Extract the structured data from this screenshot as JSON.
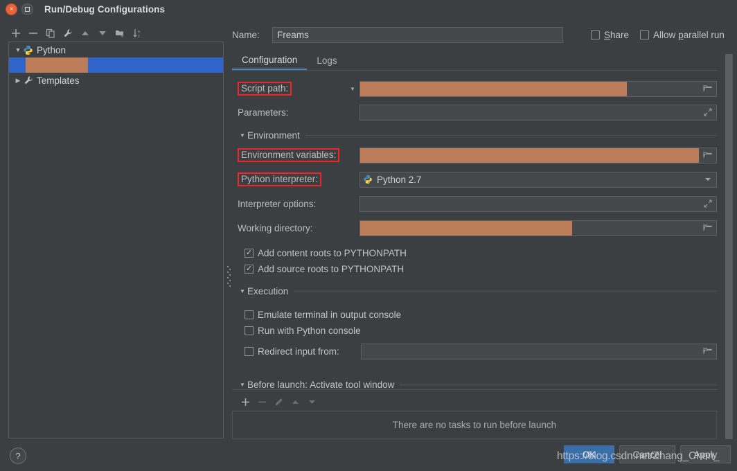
{
  "window": {
    "title": "Run/Debug Configurations",
    "close_icon": "close-icon",
    "maximize_icon": "maximize-icon"
  },
  "left_toolbar": {
    "items": [
      {
        "name": "add-configuration",
        "glyph": "+"
      },
      {
        "name": "remove-configuration",
        "glyph": "−"
      },
      {
        "name": "copy-configuration",
        "glyph": "❐"
      },
      {
        "name": "edit-templates",
        "glyph": "⚒"
      },
      {
        "name": "move-up",
        "glyph": "▲"
      },
      {
        "name": "move-down",
        "glyph": "▼"
      },
      {
        "name": "create-folder",
        "glyph": "▰"
      },
      {
        "name": "sort-configurations",
        "glyph": "↓"
      }
    ]
  },
  "tree": {
    "nodes": [
      {
        "label": "Python",
        "icon": "python-icon",
        "expanded": true,
        "triangle": "▼"
      },
      {
        "label": "",
        "icon": "",
        "selected": true,
        "redacted": true
      },
      {
        "label": "Templates",
        "icon": "wrench-icon",
        "expanded": false,
        "triangle": "▶"
      }
    ]
  },
  "help": {
    "label": "?"
  },
  "header": {
    "name_label": "Name:",
    "name_value": "Freams",
    "share_label": "Share",
    "share_checked": false,
    "allow_parallel_label": "Allow parallel run",
    "allow_parallel_checked": false
  },
  "tabs": [
    {
      "label": "Configuration",
      "active": true
    },
    {
      "label": "Logs",
      "active": false
    }
  ],
  "form": {
    "script_path_label": "Script path:",
    "script_path_value": "",
    "parameters_label": "Parameters:",
    "parameters_value": "",
    "environment_section": "Environment",
    "env_vars_label": "Environment variables:",
    "env_vars_value": "",
    "interpreter_label": "Python interpreter:",
    "interpreter_value": "Python 2.7",
    "interpreter_options_label": "Interpreter options:",
    "interpreter_options_value": "",
    "working_dir_label": "Working directory:",
    "working_dir_value": "",
    "add_content_roots_label": "Add content roots to PYTHONPATH",
    "add_content_roots_checked": true,
    "add_source_roots_label": "Add source roots to PYTHONPATH",
    "add_source_roots_checked": true,
    "execution_section": "Execution",
    "emulate_terminal_label": "Emulate terminal in output console",
    "emulate_terminal_checked": false,
    "run_with_console_label": "Run with Python console",
    "run_with_console_checked": false,
    "redirect_input_label": "Redirect input from:",
    "redirect_input_checked": false,
    "redirect_input_value": ""
  },
  "before_launch": {
    "section": "Before launch: Activate tool window",
    "toolbar": [
      {
        "name": "add-task",
        "glyph": "+"
      },
      {
        "name": "remove-task",
        "glyph": "−"
      },
      {
        "name": "edit-task",
        "glyph": "✎"
      },
      {
        "name": "move-task-up",
        "glyph": "▲"
      },
      {
        "name": "move-task-down",
        "glyph": "▼"
      }
    ],
    "empty_text": "There are no tasks to run before launch"
  },
  "footer": {
    "ok_label": "OK",
    "cancel_label": "Cancel",
    "apply_label": "Apply"
  },
  "watermark": {
    "text": "https://blog.csdn.net/Zhang_Chen_"
  },
  "colors": {
    "window_bg": "#3c3f41",
    "field_bg": "#45484a",
    "redaction": "#bc7d58",
    "selection_blue": "#2f65ca",
    "accent_tab": "#4a88c7",
    "highlight_box": "#f0262b",
    "primary_button": "#3a6ea8"
  }
}
